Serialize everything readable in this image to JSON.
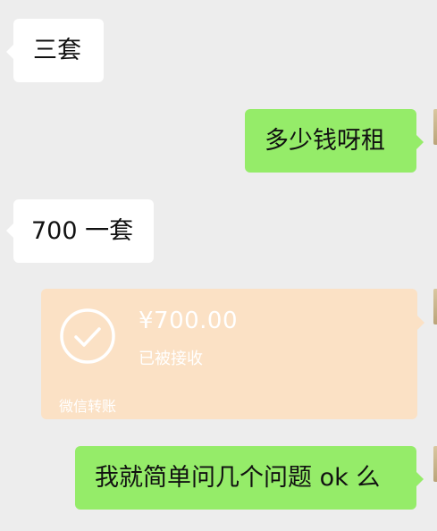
{
  "messages": [
    {
      "side": "in",
      "text": "三套"
    },
    {
      "side": "out",
      "text": "多少钱呀租"
    },
    {
      "side": "in",
      "text": "700 一套"
    },
    {
      "side": "out",
      "text": "我就简单问几个问题 ok 么"
    }
  ],
  "transfer": {
    "amount": "¥700.00",
    "status": "已被接收",
    "footer": "微信转账",
    "icon": "check-circle-icon"
  },
  "colors": {
    "background": "#ededed",
    "incoming_bubble": "#ffffff",
    "outgoing_bubble": "#95ec69",
    "transfer_card": "#fbe1c5"
  }
}
